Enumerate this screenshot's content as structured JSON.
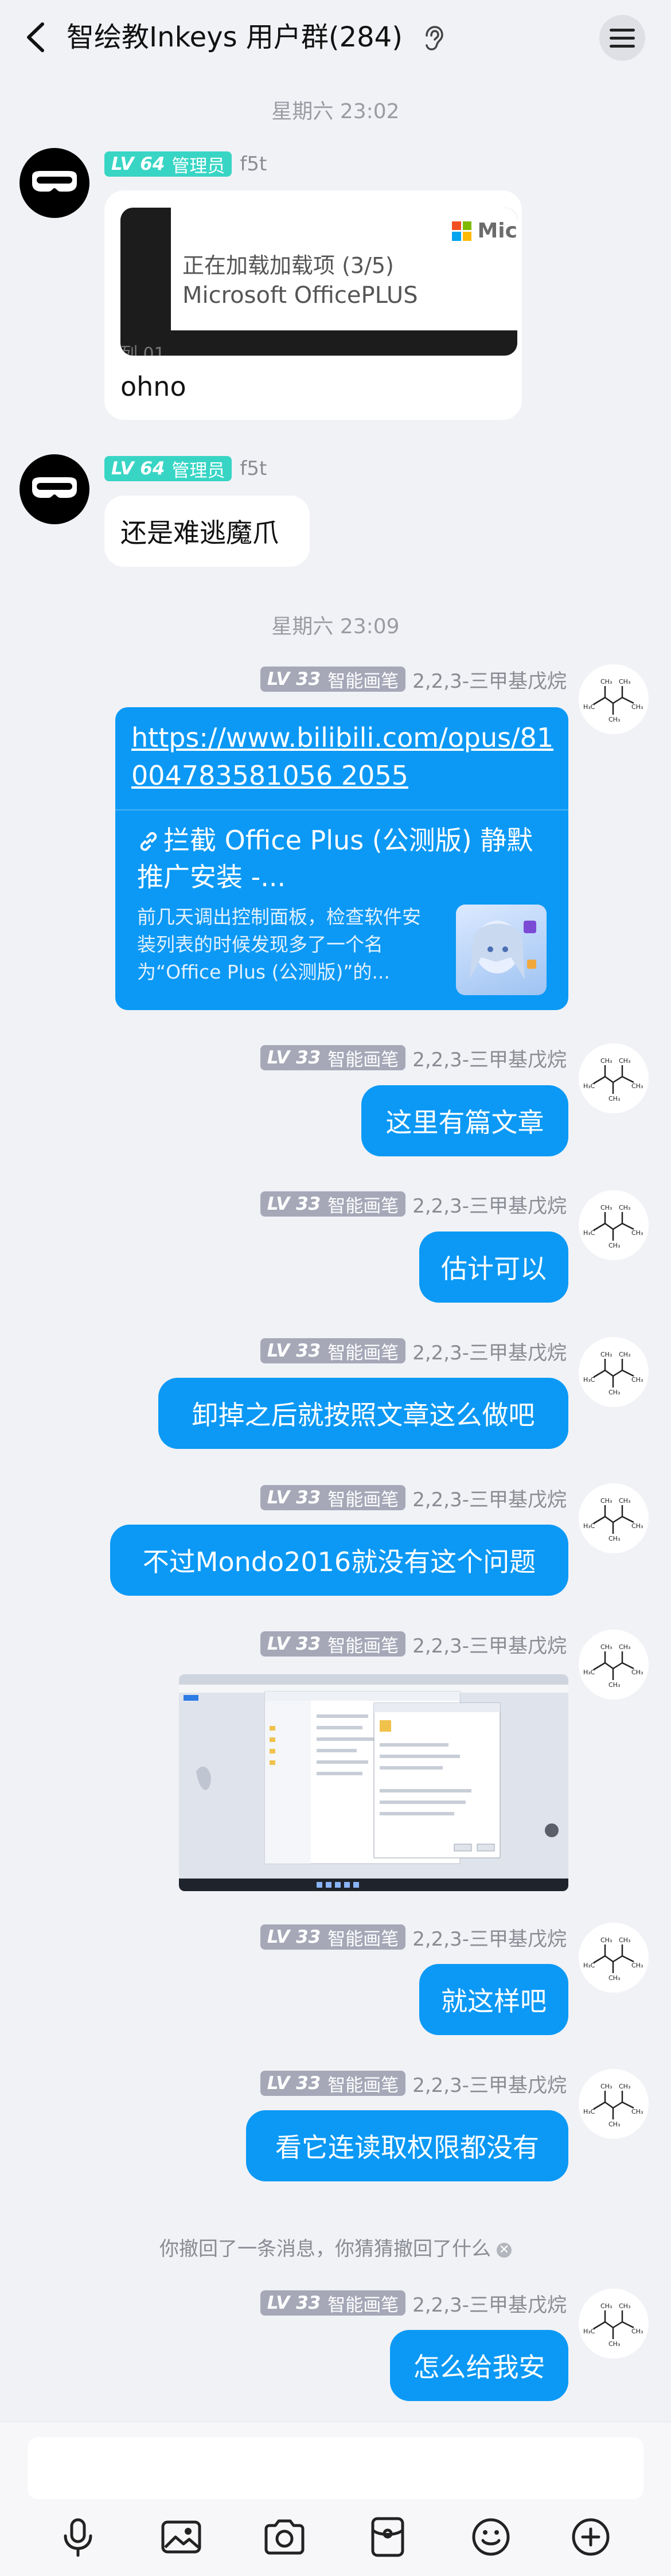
{
  "header": {
    "title": "智绘教Inkeys 用户群(284)"
  },
  "time_separators": [
    "星期六 23:02",
    "星期六 23:09"
  ],
  "users": {
    "admin": {
      "level": "LV 64",
      "role": "管理员",
      "name": "f5t"
    },
    "me": {
      "level": "LV 33",
      "role": "智能画笔",
      "name": "2,2,3-三甲基戊烷"
    }
  },
  "messages": {
    "m1": {
      "toast_line1": "正在加载加载项 (3/5)",
      "toast_line2": "Microsoft OfficePLUS",
      "toast_brand": "Mic",
      "toast_under": "列 01",
      "text": "ohno"
    },
    "m2": {
      "text": "还是难逃魔爪"
    },
    "m3": {
      "url": "https://www.bilibili.com/opus/81004783581056 2055",
      "title": "拦截 Office Plus (公测版) 静默推广安装 -...",
      "desc": "前几天调出控制面板，检查软件安装列表的时候发现多了一个名为“Office Plus (公测版)”的..."
    },
    "m4": {
      "text": "这里有篇文章"
    },
    "m5": {
      "text": "估计可以"
    },
    "m6": {
      "text": "卸掉之后就按照文章这么做吧"
    },
    "m7": {
      "text": "不过Mondo2016就没有这个问题"
    },
    "m9": {
      "text": "就这样吧"
    },
    "m10": {
      "text": "看它连读取权限都没有"
    },
    "m11": {
      "text": "怎么给我安"
    }
  },
  "recall_notice": "你撤回了一条消息，你猜猜撤回了什么",
  "colors": {
    "accent": "#0b99f5",
    "admin_badge": "#38d5c5",
    "member_badge": "#a6a8b8",
    "background": "#f1f2f6"
  },
  "toolbar": [
    "microphone-icon",
    "image-icon",
    "camera-icon",
    "red-packet-icon",
    "emoji-icon",
    "plus-icon"
  ]
}
